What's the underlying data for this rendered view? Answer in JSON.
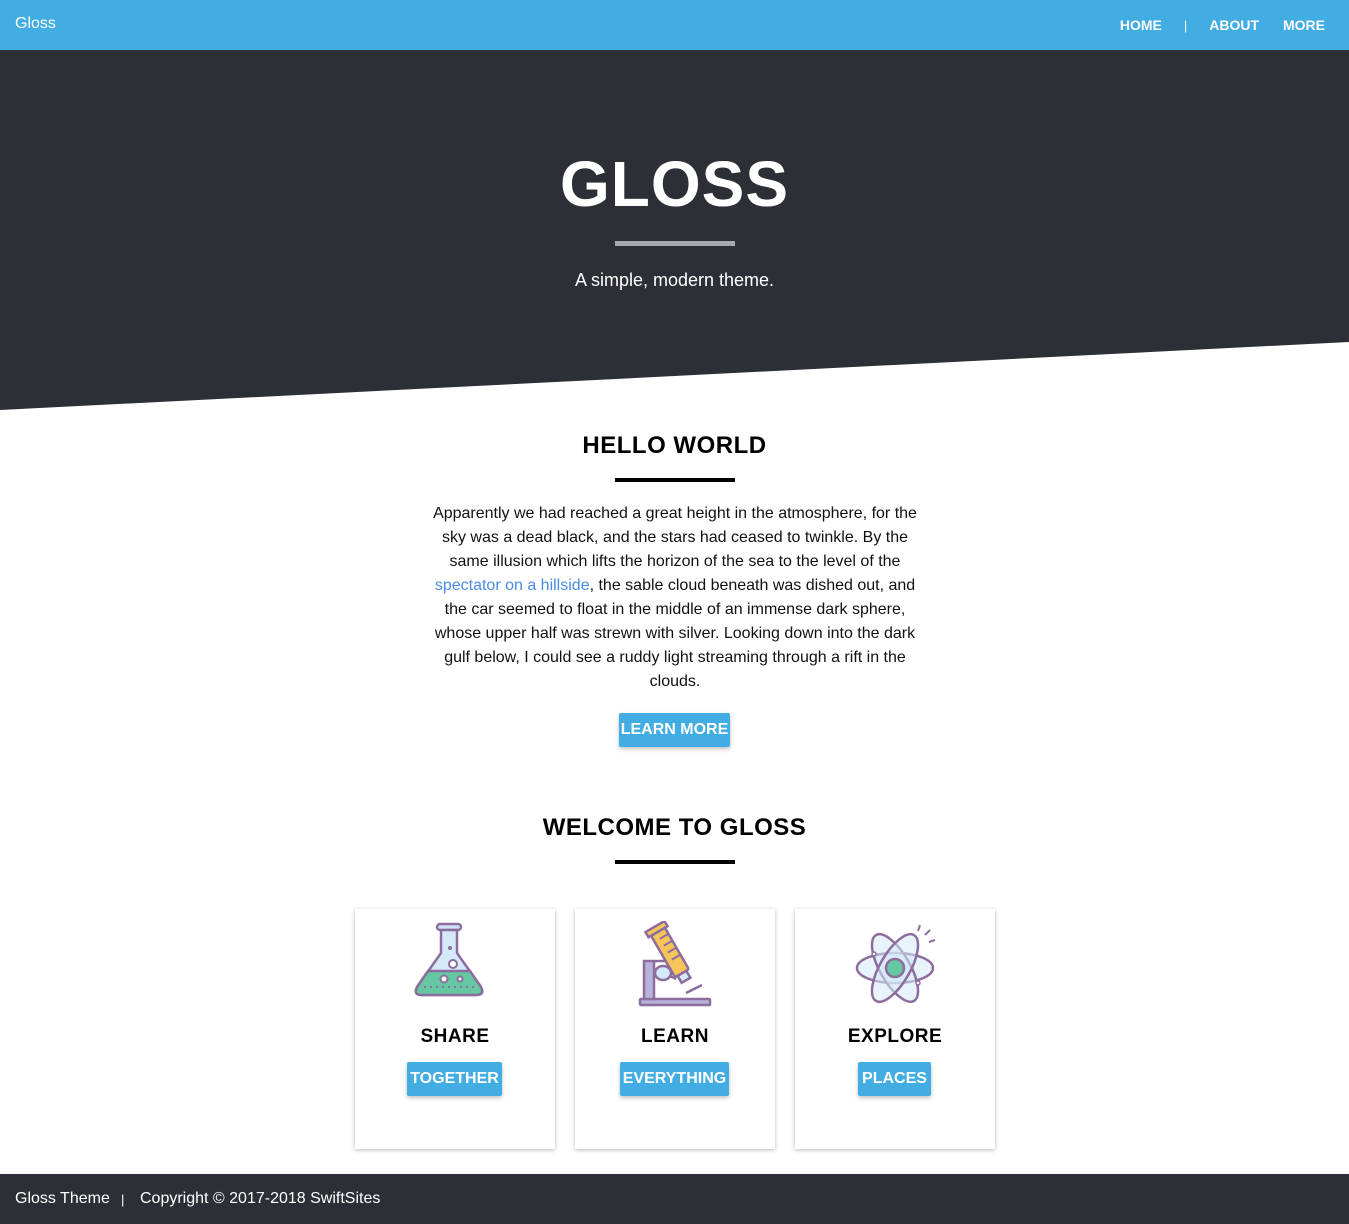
{
  "navbar": {
    "brand": "Gloss",
    "links": [
      "HOME",
      "ABOUT",
      "MORE"
    ],
    "separator": "|"
  },
  "hero": {
    "title": "GLOSS",
    "subtitle": "A simple, modern theme."
  },
  "hello": {
    "title": "HELLO WORLD",
    "text_before": "Apparently we had reached a great height in the atmosphere, for the sky was a dead black, and the stars had ceased to twinkle. By the same illusion which lifts the horizon of the sea to the level of the ",
    "link_text": "spectator on a hillside",
    "text_after": ", the sable cloud beneath was dished out, and the car seemed to float in the middle of an immense dark sphere, whose upper half was strewn with silver. Looking down into the dark gulf below, I could see a ruddy light streaming through a rift in the clouds.",
    "button": "LEARN MORE"
  },
  "welcome": {
    "title": "WELCOME TO GLOSS",
    "cards": [
      {
        "icon": "flask-icon",
        "title": "SHARE",
        "button": "TOGETHER"
      },
      {
        "icon": "microscope-icon",
        "title": "LEARN",
        "button": "EVERYTHING"
      },
      {
        "icon": "atom-icon",
        "title": "EXPLORE",
        "button": "PLACES"
      }
    ]
  },
  "footer": {
    "brand": "Gloss Theme",
    "separator": "|",
    "copyright": "Copyright © 2017-2018 SwiftSites"
  },
  "colors": {
    "accent": "#42ade3",
    "dark": "#2c2f35",
    "link": "#4a8be6"
  }
}
